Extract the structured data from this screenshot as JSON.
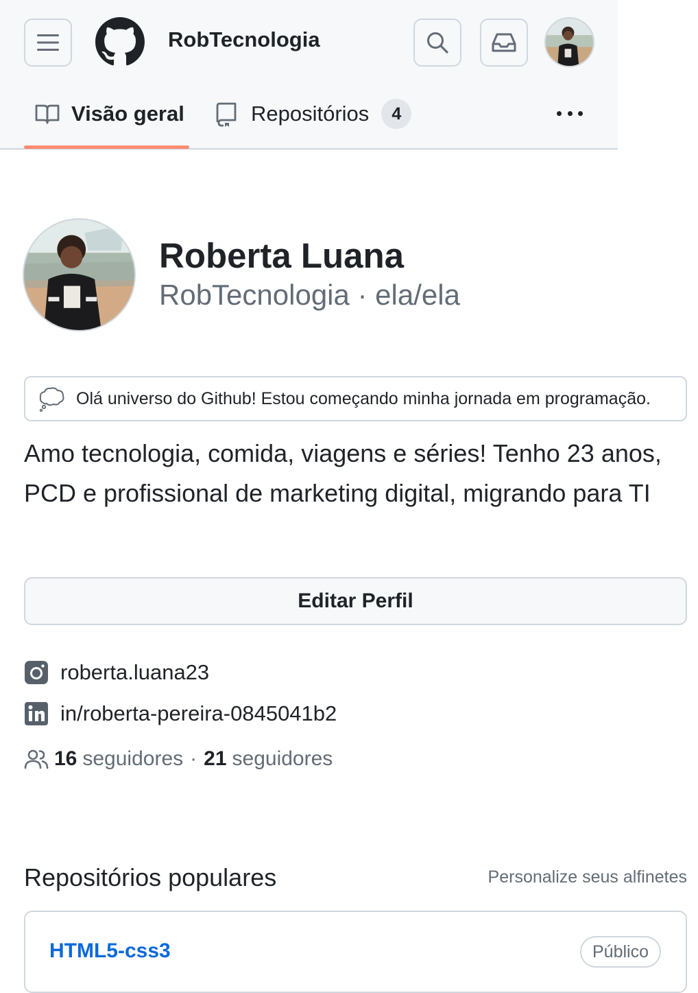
{
  "header": {
    "brand": "RobTecnologia",
    "icons": {
      "menu": "hamburger-icon",
      "logo": "github-mark-icon",
      "search": "search-icon",
      "inbox": "inbox-icon"
    }
  },
  "tabs": [
    {
      "label": "Visão geral",
      "icon": "book-icon",
      "selected": true
    },
    {
      "label": "Repositórios",
      "icon": "repo-icon",
      "count": "4",
      "selected": false
    }
  ],
  "profile": {
    "name": "Roberta Luana",
    "login_line": "RobTecnologia · ela/ela",
    "status": "Olá universo do Github! Estou começando minha jornada em programação.",
    "bio": "Amo tecnologia, comida, viagens e séries! Tenho 23 anos, PCD e profissional de marketing digital, migrando para TI",
    "edit_button": "Editar Perfil",
    "social": [
      {
        "icon": "instagram-icon",
        "text": "roberta.luana23"
      },
      {
        "icon": "linkedin-icon",
        "text": "in/roberta-pereira-0845041b2"
      }
    ],
    "followers_count": "16",
    "followers_label": "seguidores",
    "separator": "·",
    "following_count": "21",
    "following_label": "seguidores"
  },
  "popular": {
    "title": "Repositórios populares",
    "customize": "Personalize seus alfinetes",
    "repos": [
      {
        "name": "HTML5-css3",
        "visibility": "Público"
      }
    ]
  },
  "colors": {
    "accent": "#fd8c73",
    "link": "#0969da",
    "border": "#d0d7de",
    "muted": "#636c76"
  }
}
